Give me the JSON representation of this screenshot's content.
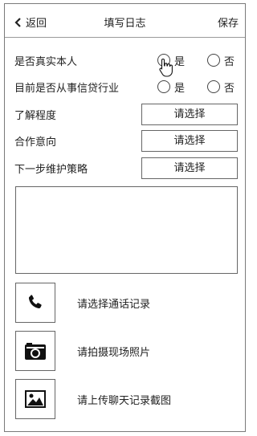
{
  "header": {
    "back_label": "返回",
    "title": "填写日志",
    "save_label": "保存"
  },
  "questions": [
    {
      "label": "是否真实本人",
      "yes": "是",
      "no": "否"
    },
    {
      "label": "目前是否从事信贷行业",
      "yes": "是",
      "no": "否"
    }
  ],
  "selects": [
    {
      "label": "了解程度",
      "value": "请选择"
    },
    {
      "label": "合作意向",
      "value": "请选择"
    },
    {
      "label": "下一步维护策略",
      "value": "请选择"
    }
  ],
  "actions": [
    {
      "label": "请选择通话记录",
      "icon": "phone-icon"
    },
    {
      "label": "请拍摄现场照片",
      "icon": "camera-icon"
    },
    {
      "label": "请上传聊天记录截图",
      "icon": "image-icon"
    }
  ]
}
